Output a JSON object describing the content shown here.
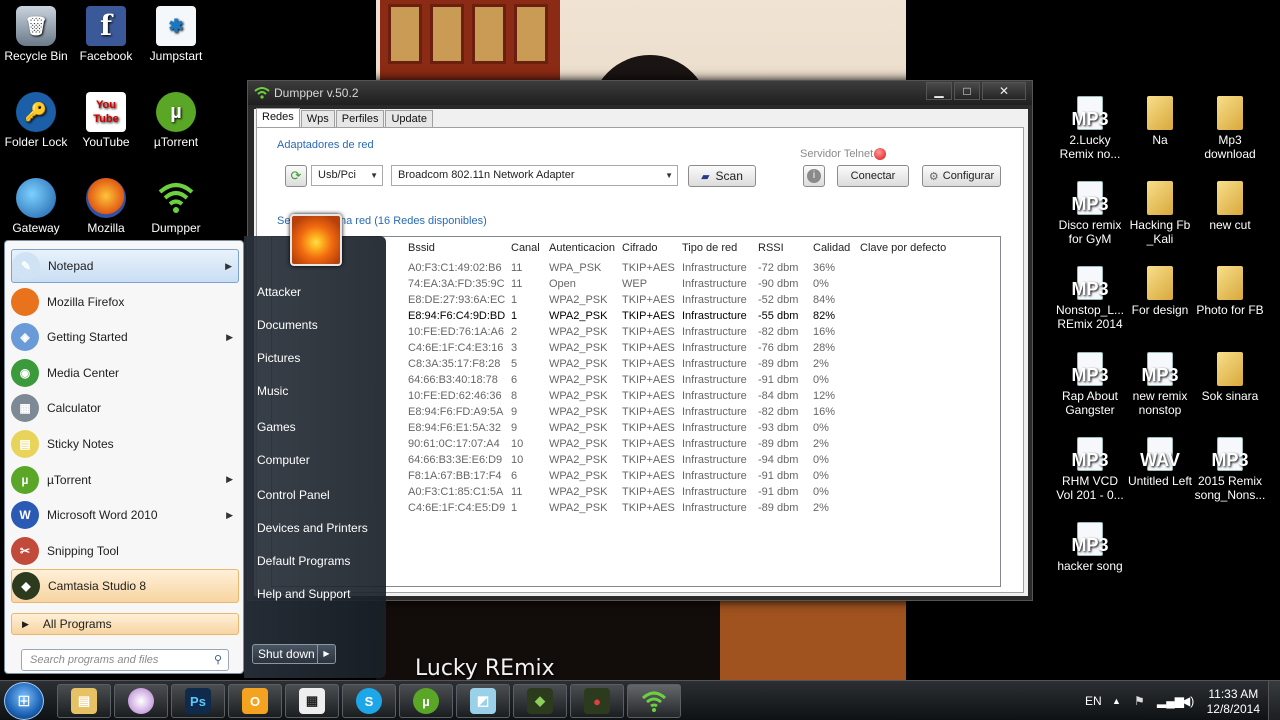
{
  "wallpaper_caption": "Lucky REmix",
  "desktop_left": [
    {
      "label": "Recycle Bin",
      "icon": "recycle-bin-icon"
    },
    {
      "label": "Facebook",
      "icon": "facebook-icon"
    },
    {
      "label": "Jumpstart",
      "icon": "jumpstart-icon"
    },
    {
      "label": "Folder Lock",
      "icon": "folder-lock-icon"
    },
    {
      "label": "YouTube",
      "icon": "youtube-icon"
    },
    {
      "label": "µTorrent",
      "icon": "utorrent-icon"
    },
    {
      "label": "Gateway",
      "icon": "gateway-icon"
    },
    {
      "label": "Mozilla",
      "icon": "firefox-icon"
    },
    {
      "label": "Dumpper",
      "icon": "dumpper-icon"
    }
  ],
  "desktop_right": [
    {
      "label": "2.Lucky Remix no...",
      "type": "MP3"
    },
    {
      "label": "Na",
      "type": "folder"
    },
    {
      "label": "Mp3 download",
      "type": "folder"
    },
    {
      "label": "Disco remix for GyM",
      "type": "MP3"
    },
    {
      "label": "Hacking Fb _Kali",
      "type": "folder"
    },
    {
      "label": "new cut",
      "type": "folder"
    },
    {
      "label": "Nonstop_L... REmix 2014",
      "type": "MP3"
    },
    {
      "label": "For design",
      "type": "folder"
    },
    {
      "label": "Photo for FB",
      "type": "folder"
    },
    {
      "label": "Rap About Gangster",
      "type": "MP3"
    },
    {
      "label": "new remix nonstop",
      "type": "MP3"
    },
    {
      "label": "Sok sinara",
      "type": "folder"
    },
    {
      "label": "RHM VCD Vol 201 - 0...",
      "type": "MP3"
    },
    {
      "label": "Untitled Left",
      "type": "WAV"
    },
    {
      "label": "2015 Remix song_Nons...",
      "type": "MP3"
    },
    {
      "label": "hacker song",
      "type": "MP3"
    }
  ],
  "dumpper": {
    "title": "Dumpper v.50.2",
    "tabs": [
      "Redes",
      "Wps",
      "Perfiles",
      "Update"
    ],
    "adapters_label": "Adaptadores de red",
    "adapter_type": "Usb/Pci",
    "adapter_name": "Broadcom 802.11n Network Adapter",
    "scan_label": "Scan",
    "telnet_label": "Servidor Telnet",
    "connect_label": "Conectar",
    "configure_label": "Configurar",
    "networks_label": "Selecciona una red (16 Redes disponibles)",
    "columns": [
      "Bssid",
      "Canal",
      "Autenticacion",
      "Cifrado",
      "Tipo de red",
      "RSSI",
      "Calidad",
      "Clave por defecto"
    ],
    "rows": [
      [
        "A0:F3:C1:49:02:B6",
        "11",
        "WPA_PSK",
        "TKIP+AES",
        "Infrastructure",
        "-72 dbm",
        "36%"
      ],
      [
        "74:EA:3A:FD:35:9C",
        "11",
        "Open",
        "WEP",
        "Infrastructure",
        "-90 dbm",
        "0%"
      ],
      [
        "E8:DE:27:93:6A:EC",
        "1",
        "WPA2_PSK",
        "TKIP+AES",
        "Infrastructure",
        "-52 dbm",
        "84%"
      ],
      [
        "E8:94:F6:C4:9D:BD",
        "1",
        "WPA2_PSK",
        "TKIP+AES",
        "Infrastructure",
        "-55 dbm",
        "82%"
      ],
      [
        "10:FE:ED:76:1A:A6",
        "2",
        "WPA2_PSK",
        "TKIP+AES",
        "Infrastructure",
        "-82 dbm",
        "16%"
      ],
      [
        "C4:6E:1F:C4:E3:16",
        "3",
        "WPA2_PSK",
        "TKIP+AES",
        "Infrastructure",
        "-76 dbm",
        "28%"
      ],
      [
        "C8:3A:35:17:F8:28",
        "5",
        "WPA2_PSK",
        "TKIP+AES",
        "Infrastructure",
        "-89 dbm",
        "2%"
      ],
      [
        "64:66:B3:40:18:78",
        "6",
        "WPA2_PSK",
        "TKIP+AES",
        "Infrastructure",
        "-91 dbm",
        "0%"
      ],
      [
        "10:FE:ED:62:46:36",
        "8",
        "WPA2_PSK",
        "TKIP+AES",
        "Infrastructure",
        "-84 dbm",
        "12%"
      ],
      [
        "E8:94:F6:FD:A9:5A",
        "9",
        "WPA2_PSK",
        "TKIP+AES",
        "Infrastructure",
        "-82 dbm",
        "16%"
      ],
      [
        "E8:94:F6:E1:5A:32",
        "9",
        "WPA2_PSK",
        "TKIP+AES",
        "Infrastructure",
        "-93 dbm",
        "0%"
      ],
      [
        "90:61:0C:17:07:A4",
        "10",
        "WPA2_PSK",
        "TKIP+AES",
        "Infrastructure",
        "-89 dbm",
        "2%"
      ],
      [
        "64:66:B3:3E:E6:D9",
        "10",
        "WPA2_PSK",
        "TKIP+AES",
        "Infrastructure",
        "-94 dbm",
        "0%"
      ],
      [
        "F8:1A:67:BB:17:F4",
        "6",
        "WPA2_PSK",
        "TKIP+AES",
        "Infrastructure",
        "-91 dbm",
        "0%"
      ],
      [
        "A0:F3:C1:85:C1:5A",
        "11",
        "WPA2_PSK",
        "TKIP+AES",
        "Infrastructure",
        "-91 dbm",
        "0%"
      ],
      [
        "C4:6E:1F:C4:E5:D9",
        "1",
        "WPA2_PSK",
        "TKIP+AES",
        "Infrastructure",
        "-89 dbm",
        "2%"
      ]
    ],
    "selected_row": 3
  },
  "start_menu": {
    "programs": [
      {
        "label": "Notepad",
        "icon": "notepad-icon",
        "submenu": true
      },
      {
        "label": "Mozilla Firefox",
        "icon": "firefox-icon",
        "submenu": false
      },
      {
        "label": "Getting Started",
        "icon": "getting-started-icon",
        "submenu": true
      },
      {
        "label": "Media Center",
        "icon": "media-center-icon",
        "submenu": false
      },
      {
        "label": "Calculator",
        "icon": "calculator-icon",
        "submenu": false
      },
      {
        "label": "Sticky Notes",
        "icon": "sticky-notes-icon",
        "submenu": false
      },
      {
        "label": "µTorrent",
        "icon": "utorrent-icon",
        "submenu": true
      },
      {
        "label": "Microsoft Word 2010",
        "icon": "word-icon",
        "submenu": true
      },
      {
        "label": "Snipping Tool",
        "icon": "snipping-tool-icon",
        "submenu": false
      },
      {
        "label": "Camtasia Studio 8",
        "icon": "camtasia-icon",
        "submenu": false
      }
    ],
    "all_programs": "All Programs",
    "search_placeholder": "Search programs and files",
    "right_items": [
      "Attacker",
      "Documents",
      "Pictures",
      "Music",
      "Games",
      "Computer",
      "Control Panel",
      "Devices and Printers",
      "Default Programs",
      "Help and Support"
    ],
    "shutdown": "Shut down"
  },
  "taskbar": {
    "language": "EN",
    "time": "11:33 AM",
    "date": "12/8/2014",
    "apps": [
      "explorer-icon",
      "app-icon",
      "photoshop-icon",
      "outlook-icon",
      "video-icon",
      "skype-icon",
      "utorrent-icon",
      "notes-icon",
      "camtasia-icon",
      "camtasia-recorder-icon",
      "dumpper-icon"
    ]
  }
}
